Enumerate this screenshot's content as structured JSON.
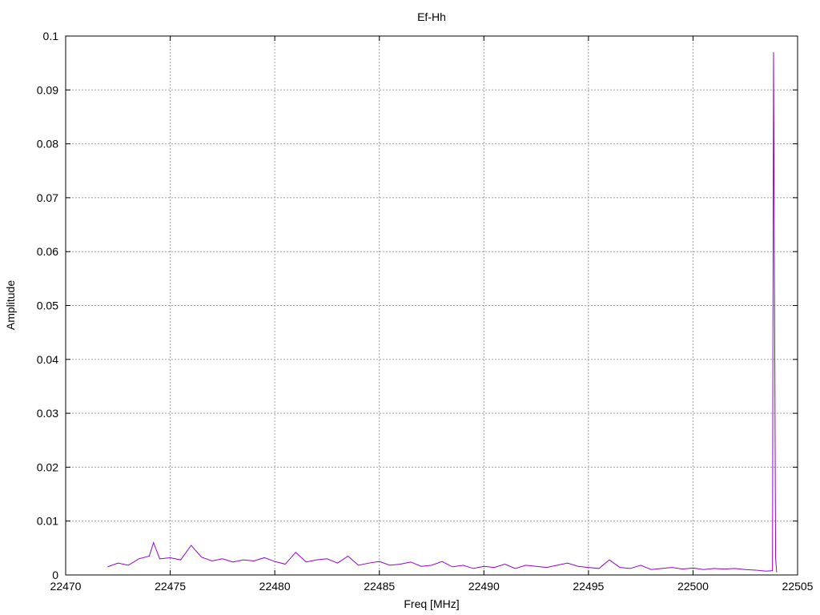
{
  "chart_data": {
    "type": "line",
    "title": "Ef-Hh",
    "xlabel": "Freq [MHz]",
    "ylabel": "Amplitude",
    "xlim": [
      22470,
      22505
    ],
    "ylim": [
      0,
      0.1
    ],
    "xticks": [
      "22470",
      "22475",
      "22480",
      "22485",
      "22490",
      "22495",
      "22500",
      "22505"
    ],
    "yticks": [
      "0",
      "0.01",
      "0.02",
      "0.03",
      "0.04",
      "0.05",
      "0.06",
      "0.07",
      "0.08",
      "0.09",
      "0.1"
    ],
    "grid": true,
    "series_color": "#9400d3",
    "series": [
      {
        "x": [
          22472.0,
          22472.5,
          22473.0,
          22473.5,
          22474.0,
          22474.2,
          22474.5,
          22475.0,
          22475.5,
          22476.0,
          22476.5,
          22477.0,
          22477.5,
          22478.0,
          22478.5,
          22479.0,
          22479.5,
          22480.0,
          22480.5,
          22481.0,
          22481.5,
          22482.0,
          22482.5,
          22483.0,
          22483.5,
          22484.0,
          22484.5,
          22485.0,
          22485.5,
          22486.0,
          22486.5,
          22487.0,
          22487.5,
          22488.0,
          22488.5,
          22489.0,
          22489.5,
          22490.0,
          22490.5,
          22491.0,
          22491.5,
          22492.0,
          22492.5,
          22493.0,
          22493.5,
          22494.0,
          22494.5,
          22495.0,
          22495.5,
          22496.0,
          22496.5,
          22497.0,
          22497.5,
          22498.0,
          22498.5,
          22499.0,
          22499.5,
          22500.0,
          22500.5,
          22501.0,
          22501.5,
          22502.0,
          22502.5,
          22503.0,
          22503.5,
          22503.8,
          22503.85,
          22503.9,
          22503.95,
          22504.0
        ],
        "y": [
          0.0015,
          0.0022,
          0.0018,
          0.003,
          0.0035,
          0.006,
          0.003,
          0.0032,
          0.0028,
          0.0055,
          0.0033,
          0.0026,
          0.003,
          0.0024,
          0.0028,
          0.0026,
          0.0032,
          0.0025,
          0.002,
          0.0042,
          0.0024,
          0.0028,
          0.003,
          0.0022,
          0.0035,
          0.0018,
          0.0022,
          0.0025,
          0.0018,
          0.002,
          0.0024,
          0.0016,
          0.0018,
          0.0025,
          0.0015,
          0.0018,
          0.0012,
          0.0016,
          0.0014,
          0.002,
          0.0012,
          0.0018,
          0.0016,
          0.0014,
          0.0018,
          0.0022,
          0.0016,
          0.0014,
          0.0012,
          0.0028,
          0.0014,
          0.0012,
          0.0018,
          0.001,
          0.0012,
          0.0014,
          0.0011,
          0.0013,
          0.001,
          0.0012,
          0.0011,
          0.0012,
          0.001,
          0.0009,
          0.0007,
          0.0008,
          0.097,
          0.05,
          0.003,
          0.0005
        ]
      }
    ]
  }
}
